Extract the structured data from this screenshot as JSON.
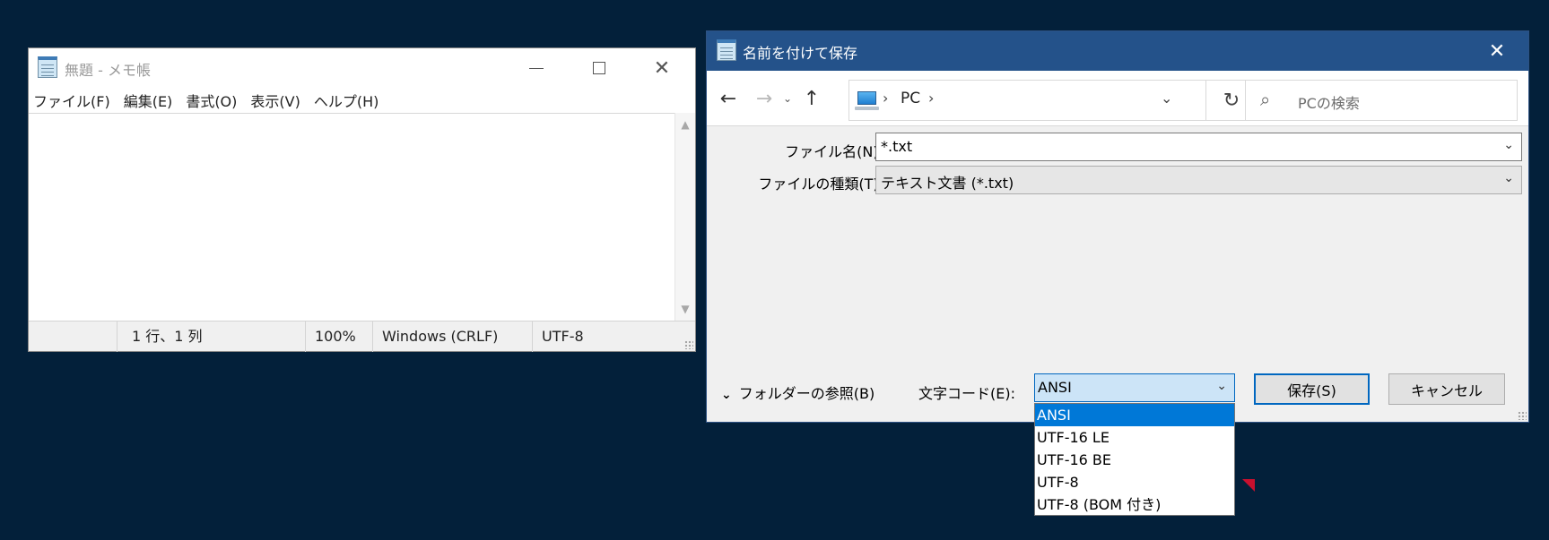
{
  "notepad": {
    "title": "無題 - メモ帳",
    "window_controls": {
      "minimize_icon": "minimize-icon",
      "maximize_icon": "maximize-icon",
      "close_glyph": "✕"
    },
    "menu": [
      "ファイル(F)",
      "編集(E)",
      "書式(O)",
      "表示(V)",
      "ヘルプ(H)"
    ],
    "content": "",
    "status": {
      "position": "1 行、1 列",
      "zoom": "100%",
      "line_ending": "Windows (CRLF)",
      "encoding": "UTF-8"
    }
  },
  "dialog": {
    "title": "名前を付けて保存",
    "close_glyph": "✕",
    "nav": {
      "back": "←",
      "forward": "→",
      "recent": "⌄",
      "up": "↑",
      "refresh": "↻"
    },
    "address": {
      "separator": "›",
      "crumb": "PC",
      "dropdown": "⌄"
    },
    "search": {
      "placeholder": "PCの検索",
      "icon": "⌕"
    },
    "fields": {
      "file_name_label": "ファイル名(N):",
      "file_name_value": "*.txt",
      "file_type_label": "ファイルの種類(T):",
      "file_type_value": "テキスト文書 (*.txt)",
      "chevron": "⌄"
    },
    "browse_folders": {
      "arrow": "⌄",
      "label": "フォルダーの参照(B)"
    },
    "encoding": {
      "label": "文字コード(E):",
      "selected": "ANSI",
      "options": [
        "ANSI",
        "UTF-16 LE",
        "UTF-16 BE",
        "UTF-8",
        "UTF-8 (BOM 付き)"
      ]
    },
    "buttons": {
      "save": "保存(S)",
      "cancel": "キャンセル"
    }
  },
  "colors": {
    "desktop": "#03203a",
    "dialog_titlebar": "#24528a",
    "accent": "#0078d7",
    "marker": "#c8102e"
  }
}
